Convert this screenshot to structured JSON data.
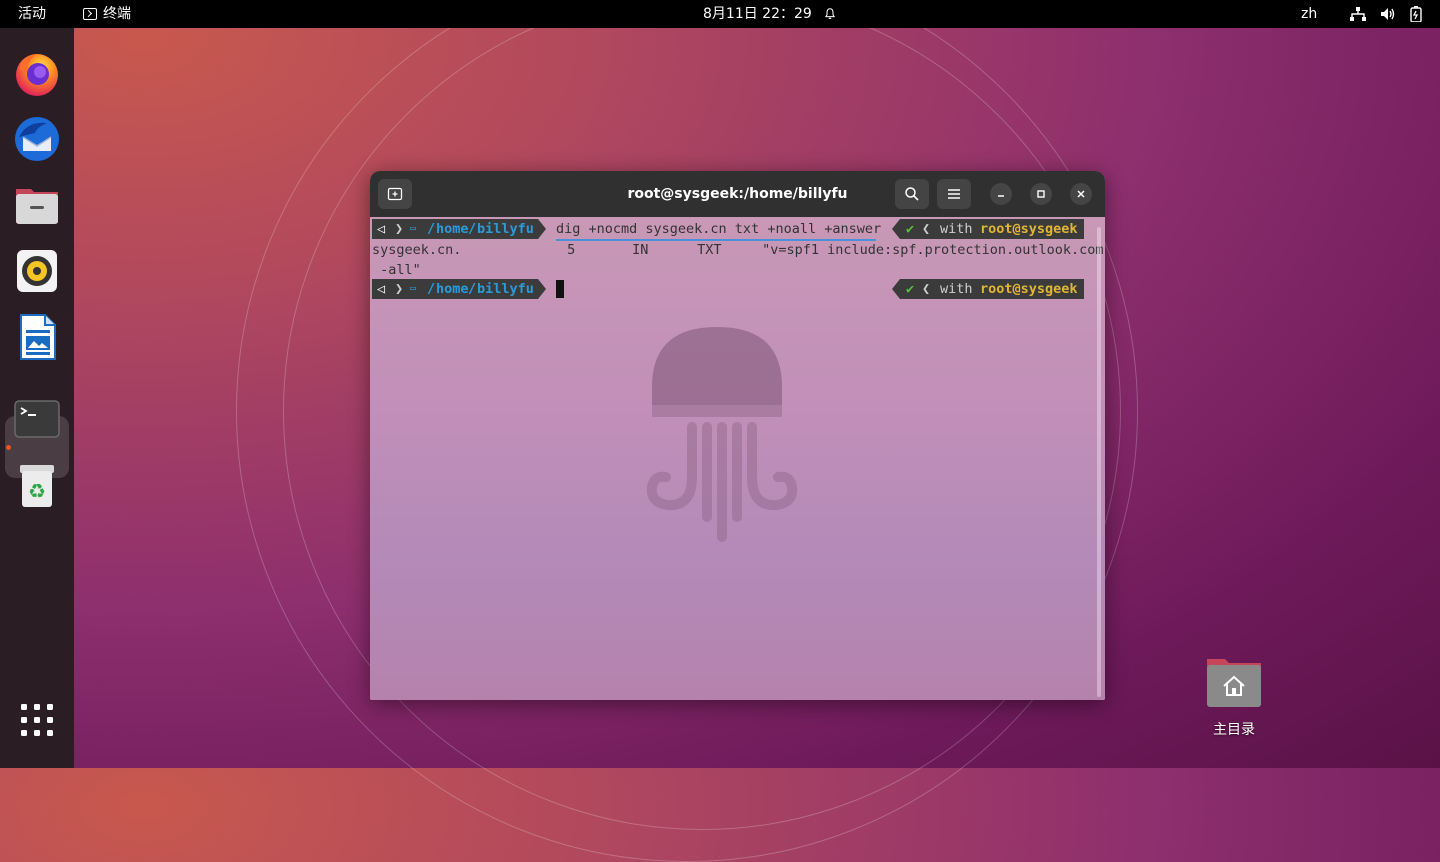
{
  "topbar": {
    "activities": "活动",
    "app_name": "终端",
    "clock": "8月11日  22：29",
    "language": "zh"
  },
  "dock": {
    "items": [
      "firefox",
      "thunderbird",
      "files",
      "rhythmbox",
      "libreoffice-writer",
      "terminal",
      "trash"
    ],
    "active": "terminal"
  },
  "terminal": {
    "title": "root@sysgeek:/home/billyfu",
    "prompt_path_slash1": "/",
    "prompt_path_home": "home",
    "prompt_path_slash2": "/",
    "prompt_path_user": "billyfu",
    "command": "dig +nocmd sysgeek.cn txt +noall +answer",
    "right_prompt_with": "with",
    "right_prompt_user": "root@sysgeek",
    "output_line1": "sysgeek.cn.             5       IN      TXT     \"v=spf1 include:spf.protection.outlook.com",
    "output_line2": " -all\""
  },
  "desktop": {
    "home_label": "主目录"
  },
  "colors": {
    "accent": "#e95420",
    "path": "#2b9bd8",
    "user": "#e2b533",
    "check": "#55c23c",
    "titlebar": "#303030"
  }
}
